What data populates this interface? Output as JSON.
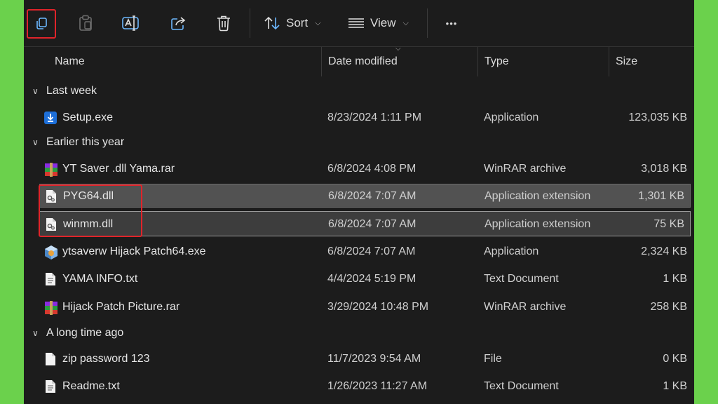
{
  "toolbar": {
    "sort_label": "Sort",
    "view_label": "View",
    "more_label": "•••"
  },
  "columns": {
    "name": "Name",
    "date": "Date modified",
    "type": "Type",
    "size": "Size"
  },
  "groups": [
    {
      "label": "Last week",
      "files": [
        {
          "name": "Setup.exe",
          "date": "8/23/2024 1:11 PM",
          "type": "Application",
          "size": "123,035 KB",
          "icon": "installer-icon"
        }
      ]
    },
    {
      "label": "Earlier this year",
      "files": [
        {
          "name": "YT Saver .dll Yama.rar",
          "date": "6/8/2024 4:08 PM",
          "type": "WinRAR archive",
          "size": "3,018 KB",
          "icon": "winrar-icon"
        },
        {
          "name": "PYG64.dll",
          "date": "6/8/2024 7:07 AM",
          "type": "Application extension",
          "size": "1,301 KB",
          "icon": "dll-file-icon"
        },
        {
          "name": "winmm.dll",
          "date": "6/8/2024 7:07 AM",
          "type": "Application extension",
          "size": "75 KB",
          "icon": "dll-file-icon"
        },
        {
          "name": "ytsaverw Hijack Patch64.exe",
          "date": "6/8/2024 7:07 AM",
          "type": "Application",
          "size": "2,324 KB",
          "icon": "app-exe-icon"
        },
        {
          "name": "YAMA INFO.txt",
          "date": "4/4/2024 5:19 PM",
          "type": "Text Document",
          "size": "1 KB",
          "icon": "text-file-icon"
        },
        {
          "name": "Hijack Patch Picture.rar",
          "date": "3/29/2024 10:48 PM",
          "type": "WinRAR archive",
          "size": "258 KB",
          "icon": "winrar-icon"
        }
      ]
    },
    {
      "label": "A long time ago",
      "files": [
        {
          "name": "zip password 123",
          "date": "11/7/2023 9:54 AM",
          "type": "File",
          "size": "0 KB",
          "icon": "blank-file-icon"
        },
        {
          "name": "Readme.txt",
          "date": "1/26/2023 11:27 AM",
          "type": "Text Document",
          "size": "1 KB",
          "icon": "text-file-icon"
        }
      ]
    }
  ]
}
